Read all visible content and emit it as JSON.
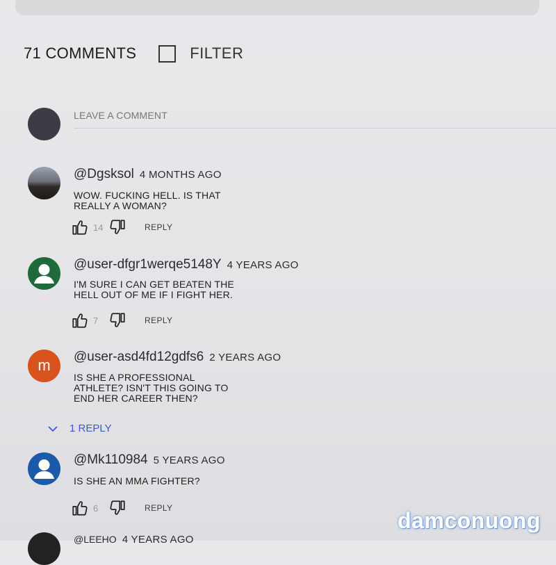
{
  "header": {
    "count_label": "71 COMMENTS",
    "filter_label": "FILTER"
  },
  "composer": {
    "placeholder": "LEAVE A COMMENT"
  },
  "comments": [
    {
      "handle": "@Dgsksol",
      "ago": "4 MONTHS AGO",
      "text": "WOW. FUCKING HELL. IS THAT REALLY A WOMAN?",
      "likes": "14",
      "reply_label": "REPLY",
      "avatar": "photo"
    },
    {
      "handle": "@user-dfgr1werqe5148Y",
      "ago": "4 YEARS AGO",
      "text": "I'M SURE I CAN GET BEATEN THE HELL OUT OF ME IF I FIGHT HER.",
      "likes": "7",
      "reply_label": "REPLY",
      "avatar": "default-green"
    },
    {
      "handle": "@user-asd4fd12gdfs6",
      "ago": "2 YEARS AGO",
      "text": "IS SHE A PROFESSIONAL ATHLETE? ISN'T THIS GOING TO END HER CAREER THEN?",
      "avatar_letter": "m",
      "replies_label": "1 REPLY"
    },
    {
      "handle": "@Mk110984",
      "ago": "5 YEARS AGO",
      "text": "IS SHE AN MMA FIGHTER?",
      "likes": "6",
      "reply_label": "REPLY",
      "avatar": "default-blue"
    },
    {
      "handle": "@LEEHO",
      "ago": "4 YEARS AGO"
    }
  ],
  "watermark": "damconuong",
  "colors": {
    "accent_link": "#3d55d8",
    "background": "#e6e6e9"
  }
}
